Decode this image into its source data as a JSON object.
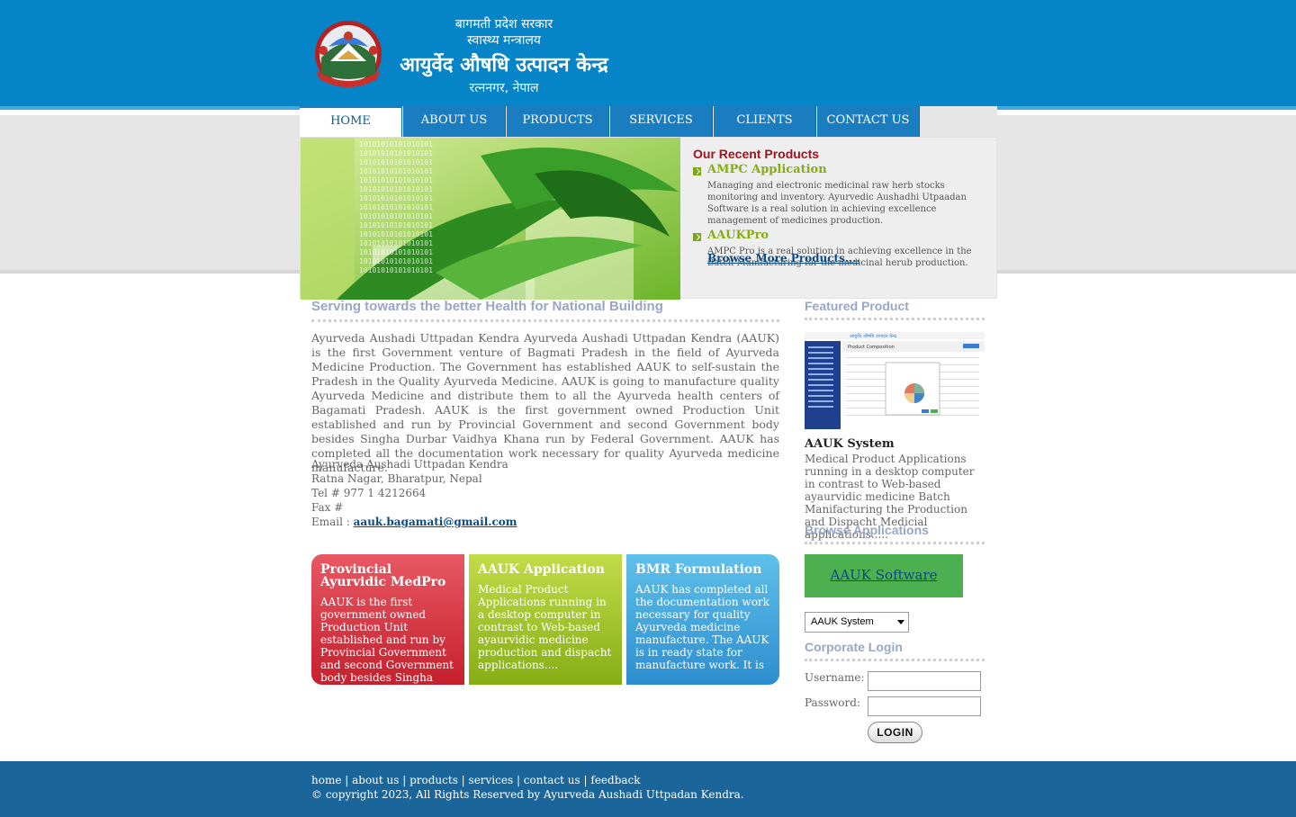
{
  "header": {
    "line1": "बागमती प्रदेश सरकार",
    "line2": "स्वास्थ्य मन्त्रालय",
    "line3": "आयुर्वेद औषधि उत्पादन केन्द्र",
    "line4": "रत्ननगर, नेपाल"
  },
  "nav": {
    "items": [
      {
        "label": "HOME"
      },
      {
        "label": "ABOUT US"
      },
      {
        "label": "PRODUCTS"
      },
      {
        "label": "SERVICES"
      },
      {
        "label": "CLIENTS"
      },
      {
        "label": "CONTACT US"
      }
    ],
    "active": "HOME"
  },
  "banner": {
    "binary_text": "10101010101010101"
  },
  "recent": {
    "heading": "Our Recent Products",
    "products": [
      {
        "title": "AMPC Application",
        "desc": "Managing and electronic medicinal raw herb stocks monitoring and inventory. Ayurvedic Aushadhi Utpaadan Software is a real solution in achieving excellence management of medicines production."
      },
      {
        "title": "AAUKPro",
        "desc": "AMPC Pro is a real solution in achieving excellence in the Batch Manifacturing for the medicinal herub production."
      }
    ],
    "browse_more": "Browse More Products...."
  },
  "main": {
    "title": "Serving towards the better Health for National Building",
    "intro": "Ayurveda Aushadi Uttpadan Kendra Ayurveda Aushadi Uttpadan Kendra (AAUK) is the first Government venture of Bagmati Pradesh in the field of Ayurveda Medicine Production. The Government has established AAUK to self-sustain the Pradesh in the Quality Ayurveda Medicine. AAUK is going to manufacture quality Ayurveda Medicine and distribute them to all the Ayurveda health centers of Bagamati Pradesh. AAUK is the first government owned Production Unit established and run by Provincial Government and second Government body besides Singha Durbar Vaidhya Khana run by Federal Government. AAUK has completed all the documentation work necessary for quality Ayurveda medicine manufacture.",
    "address": {
      "name": "Ayurveda Aushadi Uttpadan Kendra",
      "location": "Ratna Nagar, Bharatpur, Nepal",
      "tel": "Tel # 977 1 4212664",
      "fax": "Fax #",
      "email_label": "Email : ",
      "email": "aauk.bagamati@gmail.com"
    }
  },
  "cards": [
    {
      "title": "Provincial Ayurvidic MedPro",
      "text": "AAUK is the first government owned Production Unit established and run by Provincial Government and second Government body besides Singha Durbar Vaidhya",
      "color": "#d4303d"
    },
    {
      "title": "AAUK Application",
      "text": "Medical Product Applications running in a desktop computer in contrast to Web-based ayaurvidic medicine production and dispacht applications....",
      "color": "#9fc21f"
    },
    {
      "title": "BMR Formulation",
      "text": "AAUK has completed all the documentation work necessary for quality Ayurveda medicine manufacture. The AAUK is in ready state for manufacture work. It is",
      "color": "#3ea3dc"
    }
  ],
  "sidebar": {
    "featured_title": "Featured Product",
    "feat_header_text": "आयुर्वेद औषधि उत्पादन केन्द्र",
    "feat_window_title": "Product Composition",
    "feat_name": "AAUK System",
    "feat_desc": "Medical Product Applications running in a desktop computer in contrast to Web-based ayaurvidic medicine Batch Manifacturing the Production and Dispacht Medicial applications.....",
    "browse_title": "Browse Applications",
    "app_button": "AAUK Software",
    "app_select_value": "AAUK System",
    "login_title": "Corporate Login",
    "username_label": "Username:",
    "password_label": "Password:",
    "login_button": "LOGIN"
  },
  "footer": {
    "links": [
      "home",
      "about us",
      "products",
      "services",
      "contact us",
      "feedback"
    ],
    "copyright": "© copyright 2023, All Rights Reserved by Ayurveda Aushadi Uttpadan Kendra."
  }
}
